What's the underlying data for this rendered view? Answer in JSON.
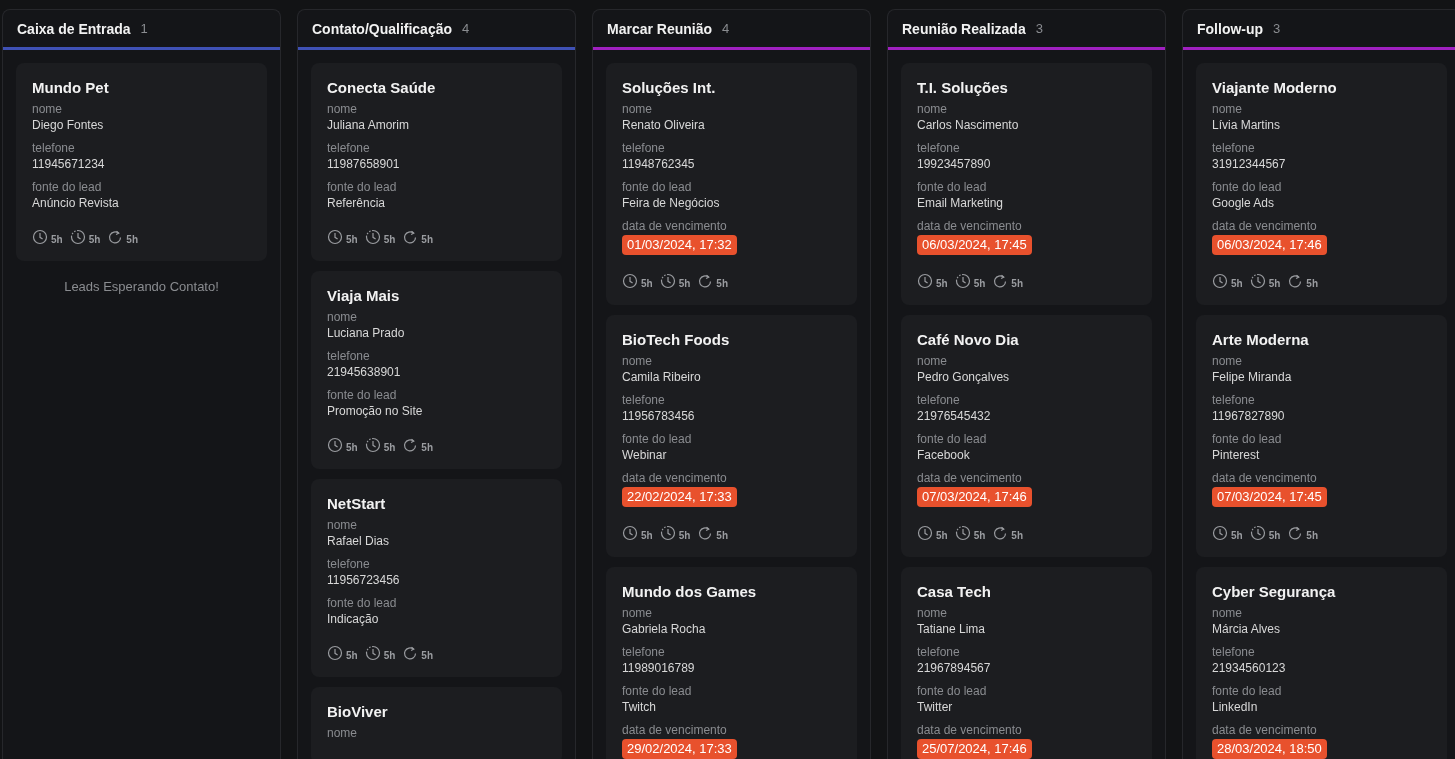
{
  "columns": [
    {
      "title": "Caixa de Entrada",
      "count": "1",
      "color": "#3f51b5",
      "cards": [
        {
          "title": "Mundo Pet",
          "fields": [
            {
              "kind": "text",
              "label": "nome",
              "value": "Diego Fontes"
            },
            {
              "kind": "text",
              "label": "telefone",
              "value": "11945671234"
            },
            {
              "kind": "text",
              "label": "fonte do lead",
              "value": "Anúncio Revista"
            }
          ],
          "timers": [
            {
              "kind": "clock",
              "text": "5h"
            },
            {
              "kind": "dashed-clock",
              "text": "5h"
            },
            {
              "kind": "refresh",
              "text": "5h"
            }
          ]
        }
      ],
      "note": "Leads Esperando Contato!"
    },
    {
      "title": "Contato/Qualificação",
      "count": "4",
      "color": "#3f51b5",
      "cards": [
        {
          "title": "Conecta Saúde",
          "fields": [
            {
              "kind": "text",
              "label": "nome",
              "value": "Juliana Amorim"
            },
            {
              "kind": "text",
              "label": "telefone",
              "value": "11987658901"
            },
            {
              "kind": "text",
              "label": "fonte do lead",
              "value": "Referência"
            }
          ],
          "timers": [
            {
              "kind": "clock",
              "text": "5h"
            },
            {
              "kind": "dashed-clock",
              "text": "5h"
            },
            {
              "kind": "refresh",
              "text": "5h"
            }
          ]
        },
        {
          "title": "Viaja Mais",
          "fields": [
            {
              "kind": "text",
              "label": "nome",
              "value": "Luciana Prado"
            },
            {
              "kind": "text",
              "label": "telefone",
              "value": "21945638901"
            },
            {
              "kind": "text",
              "label": "fonte do lead",
              "value": "Promoção no Site"
            }
          ],
          "timers": [
            {
              "kind": "clock",
              "text": "5h"
            },
            {
              "kind": "dashed-clock",
              "text": "5h"
            },
            {
              "kind": "refresh",
              "text": "5h"
            }
          ]
        },
        {
          "title": "NetStart",
          "fields": [
            {
              "kind": "text",
              "label": "nome",
              "value": "Rafael Dias"
            },
            {
              "kind": "text",
              "label": "telefone",
              "value": "11956723456"
            },
            {
              "kind": "text",
              "label": "fonte do lead",
              "value": "Indicação"
            }
          ],
          "timers": [
            {
              "kind": "clock",
              "text": "5h"
            },
            {
              "kind": "dashed-clock",
              "text": "5h"
            },
            {
              "kind": "refresh",
              "text": "5h"
            }
          ]
        },
        {
          "title": "BioViver",
          "fields": [
            {
              "kind": "text",
              "label": "nome"
            }
          ]
        }
      ]
    },
    {
      "title": "Marcar Reunião",
      "count": "4",
      "color": "#a020c0",
      "cards": [
        {
          "title": "Soluções Int.",
          "fields": [
            {
              "kind": "text",
              "label": "nome",
              "value": "Renato Oliveira"
            },
            {
              "kind": "text",
              "label": "telefone",
              "value": "11948762345"
            },
            {
              "kind": "text",
              "label": "fonte do lead",
              "value": "Feira de Negócios"
            },
            {
              "kind": "date",
              "label": "data de vencimento",
              "value": "01/03/2024, 17:32",
              "overdue": true
            }
          ],
          "timers": [
            {
              "kind": "clock",
              "text": "5h"
            },
            {
              "kind": "dashed-clock",
              "text": "5h"
            },
            {
              "kind": "refresh",
              "text": "5h"
            }
          ]
        },
        {
          "title": "BioTech Foods",
          "fields": [
            {
              "kind": "text",
              "label": "nome",
              "value": "Camila Ribeiro"
            },
            {
              "kind": "text",
              "label": "telefone",
              "value": "11956783456"
            },
            {
              "kind": "text",
              "label": "fonte do lead",
              "value": "Webinar"
            },
            {
              "kind": "date",
              "label": "data de vencimento",
              "value": "22/02/2024, 17:33",
              "overdue": true
            }
          ],
          "timers": [
            {
              "kind": "clock",
              "text": "5h"
            },
            {
              "kind": "dashed-clock",
              "text": "5h"
            },
            {
              "kind": "refresh",
              "text": "5h"
            }
          ]
        },
        {
          "title": "Mundo dos Games",
          "fields": [
            {
              "kind": "text",
              "label": "nome",
              "value": "Gabriela Rocha"
            },
            {
              "kind": "text",
              "label": "telefone",
              "value": "11989016789"
            },
            {
              "kind": "text",
              "label": "fonte do lead",
              "value": "Twitch"
            },
            {
              "kind": "date",
              "label": "data de vencimento",
              "value": "29/02/2024, 17:33",
              "overdue": true
            }
          ]
        }
      ]
    },
    {
      "title": "Reunião Realizada",
      "count": "3",
      "color": "#a020c0",
      "cards": [
        {
          "title": "T.I. Soluções",
          "fields": [
            {
              "kind": "text",
              "label": "nome",
              "value": "Carlos Nascimento"
            },
            {
              "kind": "text",
              "label": "telefone",
              "value": "19923457890"
            },
            {
              "kind": "text",
              "label": "fonte do lead",
              "value": "Email Marketing"
            },
            {
              "kind": "date",
              "label": "data de vencimento",
              "value": "06/03/2024, 17:45",
              "overdue": true
            }
          ],
          "timers": [
            {
              "kind": "clock",
              "text": "5h"
            },
            {
              "kind": "dashed-clock",
              "text": "5h"
            },
            {
              "kind": "refresh",
              "text": "5h"
            }
          ]
        },
        {
          "title": "Café Novo Dia",
          "fields": [
            {
              "kind": "text",
              "label": "nome",
              "value": "Pedro Gonçalves"
            },
            {
              "kind": "text",
              "label": "telefone",
              "value": "21976545432"
            },
            {
              "kind": "text",
              "label": "fonte do lead",
              "value": "Facebook"
            },
            {
              "kind": "date",
              "label": "data de vencimento",
              "value": "07/03/2024, 17:46",
              "overdue": true
            }
          ],
          "timers": [
            {
              "kind": "clock",
              "text": "5h"
            },
            {
              "kind": "dashed-clock",
              "text": "5h"
            },
            {
              "kind": "refresh",
              "text": "5h"
            }
          ]
        },
        {
          "title": "Casa Tech",
          "fields": [
            {
              "kind": "text",
              "label": "nome",
              "value": "Tatiane Lima"
            },
            {
              "kind": "text",
              "label": "telefone",
              "value": "21967894567"
            },
            {
              "kind": "text",
              "label": "fonte do lead",
              "value": "Twitter"
            },
            {
              "kind": "date",
              "label": "data de vencimento",
              "value": "25/07/2024, 17:46",
              "overdue": true
            }
          ]
        }
      ]
    },
    {
      "title": "Follow-up",
      "count": "3",
      "color": "#a020c0",
      "cards": [
        {
          "title": "Viajante Moderno",
          "fields": [
            {
              "kind": "text",
              "label": "nome",
              "value": "Lívia Martins"
            },
            {
              "kind": "text",
              "label": "telefone",
              "value": "31912344567"
            },
            {
              "kind": "text",
              "label": "fonte do lead",
              "value": "Google Ads"
            },
            {
              "kind": "date",
              "label": "data de vencimento",
              "value": "06/03/2024, 17:46",
              "overdue": true
            }
          ],
          "timers": [
            {
              "kind": "clock",
              "text": "5h"
            },
            {
              "kind": "dashed-clock",
              "text": "5h"
            },
            {
              "kind": "refresh",
              "text": "5h"
            }
          ]
        },
        {
          "title": "Arte Moderna",
          "fields": [
            {
              "kind": "text",
              "label": "nome",
              "value": "Felipe Miranda"
            },
            {
              "kind": "text",
              "label": "telefone",
              "value": "11967827890"
            },
            {
              "kind": "text",
              "label": "fonte do lead",
              "value": "Pinterest"
            },
            {
              "kind": "date",
              "label": "data de vencimento",
              "value": "07/03/2024, 17:45",
              "overdue": true
            }
          ],
          "timers": [
            {
              "kind": "clock",
              "text": "5h"
            },
            {
              "kind": "dashed-clock",
              "text": "5h"
            },
            {
              "kind": "refresh",
              "text": "5h"
            }
          ]
        },
        {
          "title": "Cyber Segurança",
          "fields": [
            {
              "kind": "text",
              "label": "nome",
              "value": "Márcia Alves"
            },
            {
              "kind": "text",
              "label": "telefone",
              "value": "21934560123"
            },
            {
              "kind": "text",
              "label": "fonte do lead",
              "value": "LinkedIn"
            },
            {
              "kind": "date",
              "label": "data de vencimento",
              "value": "28/03/2024, 18:50",
              "overdue": true
            }
          ]
        }
      ]
    }
  ]
}
